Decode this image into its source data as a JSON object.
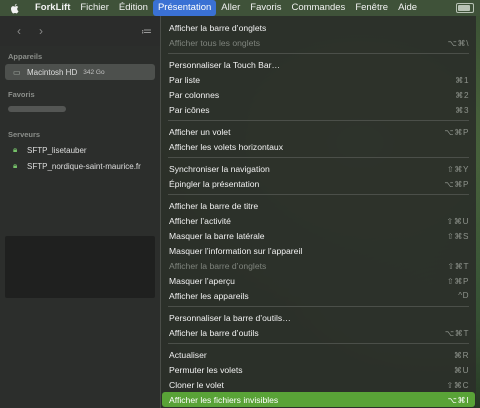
{
  "menubar": {
    "apple_icon": "apple-logo-icon",
    "app": "ForkLift",
    "items": [
      "Fichier",
      "Édition",
      "Présentation",
      "Aller",
      "Favoris",
      "Commandes",
      "Fenêtre",
      "Aide"
    ],
    "active": "Présentation"
  },
  "toolbar": {
    "back": "‹",
    "forward": "›",
    "view_icon": "≔"
  },
  "sidebar": {
    "devices_title": "Appareils",
    "device_name": "Macintosh HD",
    "device_size": "342 Go",
    "favorites_title": "Favoris",
    "servers_title": "Serveurs",
    "servers": [
      "SFTP_lisetauber",
      "SFTP_nordique-saint-maurice.fr"
    ]
  },
  "menu": {
    "items": [
      {
        "label": "Afficher la barre d’onglets",
        "shortcut": "",
        "disabled": false
      },
      {
        "label": "Afficher tous les onglets",
        "shortcut": "⌥⌘\\",
        "disabled": true
      },
      {
        "sep": true
      },
      {
        "label": "Personnaliser la Touch Bar…",
        "shortcut": "",
        "disabled": false
      },
      {
        "label": "Par liste",
        "shortcut": "⌘1",
        "disabled": false
      },
      {
        "label": "Par colonnes",
        "shortcut": "⌘2",
        "disabled": false
      },
      {
        "label": "Par icônes",
        "shortcut": "⌘3",
        "disabled": false
      },
      {
        "sep": true
      },
      {
        "label": "Afficher un volet",
        "shortcut": "⌥⌘P",
        "disabled": false
      },
      {
        "label": "Afficher les volets horizontaux",
        "shortcut": "",
        "disabled": false
      },
      {
        "sep": true
      },
      {
        "label": "Synchroniser la navigation",
        "shortcut": "⇧⌘Y",
        "disabled": false
      },
      {
        "label": "Épingler la présentation",
        "shortcut": "⌥⌘P",
        "disabled": false
      },
      {
        "sep": true
      },
      {
        "label": "Afficher la barre de titre",
        "shortcut": "",
        "disabled": false
      },
      {
        "label": "Afficher l’activité",
        "shortcut": "⇧⌘U",
        "disabled": false
      },
      {
        "label": "Masquer la barre latérale",
        "shortcut": "⇧⌘S",
        "disabled": false
      },
      {
        "label": "Masquer l’information sur l’appareil",
        "shortcut": "",
        "disabled": false
      },
      {
        "label": "Afficher la barre d’onglets",
        "shortcut": "⇧⌘T",
        "disabled": true
      },
      {
        "label": "Masquer l’aperçu",
        "shortcut": "⇧⌘P",
        "disabled": false
      },
      {
        "label": "Afficher les appareils",
        "shortcut": "^D",
        "disabled": false
      },
      {
        "sep": true
      },
      {
        "label": "Personnaliser la barre d’outils…",
        "shortcut": "",
        "disabled": false
      },
      {
        "label": "Afficher la barre d’outils",
        "shortcut": "⌥⌘T",
        "disabled": false
      },
      {
        "sep": true
      },
      {
        "label": "Actualiser",
        "shortcut": "⌘R",
        "disabled": false
      },
      {
        "label": "Permuter les volets",
        "shortcut": "⌘U",
        "disabled": false
      },
      {
        "label": "Cloner le volet",
        "shortcut": "⇧⌘C",
        "disabled": false
      },
      {
        "label": "Afficher les fichiers invisibles",
        "shortcut": "⌥⌘I",
        "disabled": false,
        "highlight": true
      }
    ]
  }
}
